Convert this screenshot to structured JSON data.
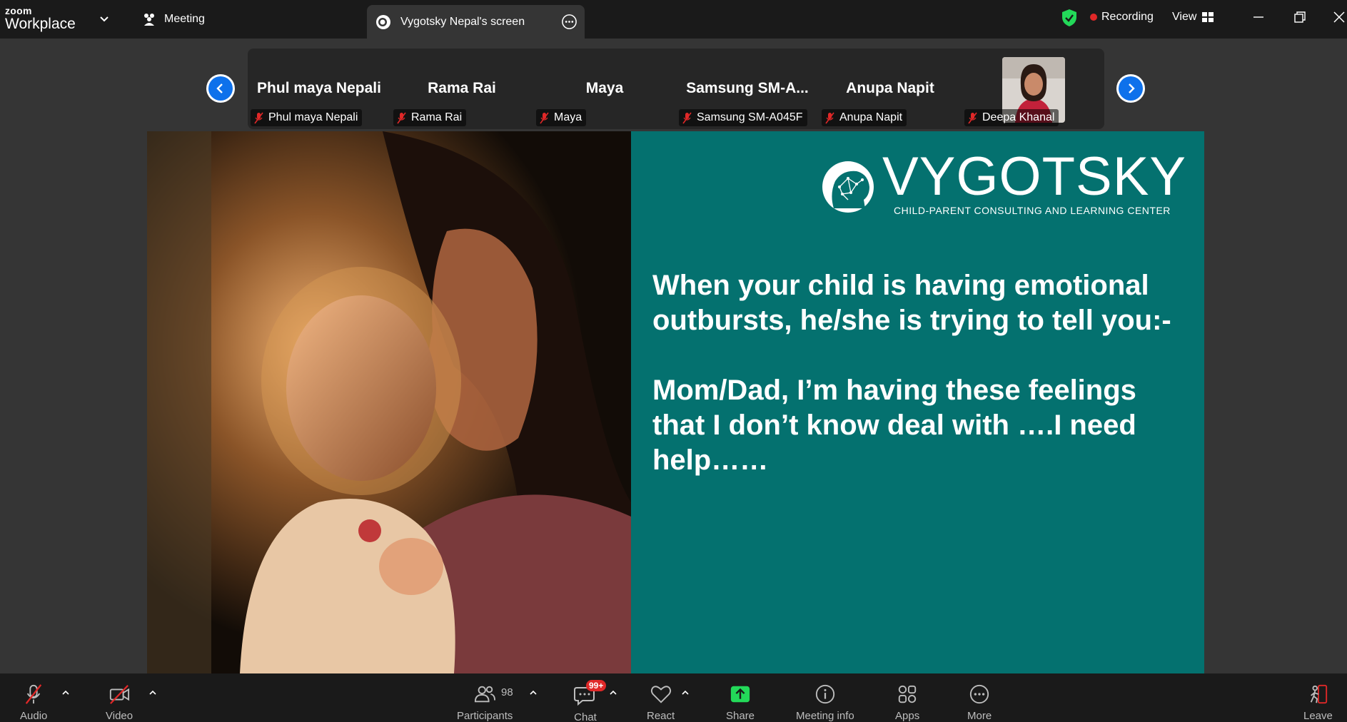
{
  "titlebar": {
    "brand_top": "zoom",
    "brand_bottom": "Workplace",
    "meeting_tab": "Meeting",
    "share_tab": "Vygotsky Nepal's screen",
    "recording": "Recording",
    "view": "View"
  },
  "participants": [
    {
      "display": "Phul maya Nepali",
      "label": "Phul maya Nepali"
    },
    {
      "display": "Rama Rai",
      "label": "Rama Rai"
    },
    {
      "display": "Maya",
      "label": "Maya"
    },
    {
      "display": "Samsung  SM-A...",
      "label": "Samsung SM-A045F"
    },
    {
      "display": "Anupa Napit",
      "label": "Anupa Napit"
    },
    {
      "display": "",
      "label": "Deepa Khanal"
    }
  ],
  "slide": {
    "logo_word": "VYGOTSKY",
    "logo_tagline": "CHILD-PARENT CONSULTING AND LEARNING CENTER",
    "line1": "When your child is having emotional",
    "line2": "outbursts, he/she is trying to tell you:-",
    "line3": "Mom/Dad, I’m having these feelings",
    "line4": "that I don’t know deal with ….I need",
    "line5": "help……",
    "panel_color": "#04716f"
  },
  "toolbar": {
    "audio": "Audio",
    "video": "Video",
    "participants": "Participants",
    "participants_count": "98",
    "chat": "Chat",
    "chat_badge": "99+",
    "react": "React",
    "share": "Share",
    "meeting_info": "Meeting info",
    "apps": "Apps",
    "more": "More",
    "leave": "Leave"
  },
  "colors": {
    "accent_blue": "#0e71eb",
    "share_green": "#23d959",
    "alert_red": "#e02828"
  }
}
